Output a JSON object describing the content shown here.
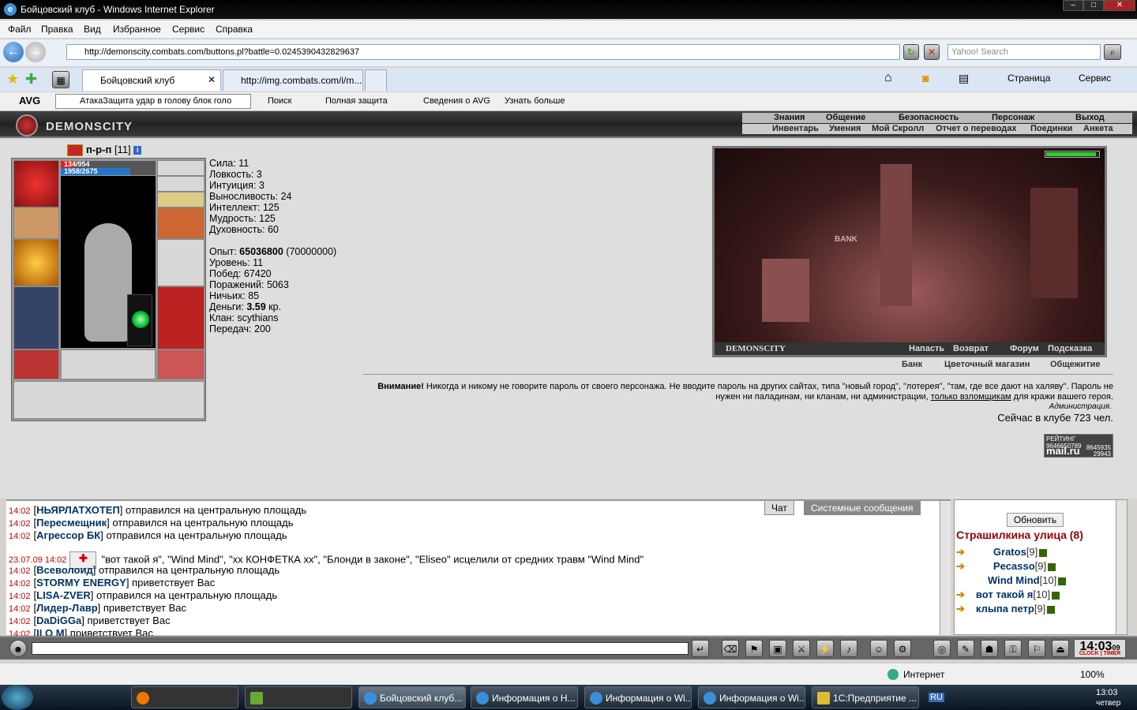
{
  "window": {
    "title": "Бойцовский клуб - Windows Internet Explorer"
  },
  "menu": [
    "Файл",
    "Правка",
    "Вид",
    "Избранное",
    "Сервис",
    "Справка"
  ],
  "address": {
    "url": "http://demonscity.combats.com/buttons.pl?battle=0.0245390432829637",
    "search_placeholder": "Yahoo! Search"
  },
  "tabs": [
    "Бойцовский клуб",
    "http://img.combats.com/i/m..."
  ],
  "ietools": {
    "page": "Страница",
    "service": "Сервис"
  },
  "avg": {
    "label": "AVG",
    "search_value": "АтакаЗащита   удар в голову блок голо",
    "search_btn": "Поиск",
    "full": "Полная защита",
    "info": "Сведения о AVG",
    "more": "Узнать больше"
  },
  "game": {
    "logo": "DEMONSCITY",
    "topnav": [
      "Знания",
      "Общение",
      "Безопасность",
      "Персонаж",
      "Выход"
    ],
    "subnav": [
      "Инвентарь",
      "Умения",
      "Мой Скролл",
      "Отчет о переводах",
      "Поединки",
      "Анкета"
    ]
  },
  "character": {
    "name": "п-р-п",
    "level": "[11]",
    "info_icon": "i",
    "hp": "134/954",
    "hp_fraction": 0.14,
    "mp": "1958/2675",
    "mp_fraction": 0.73,
    "stats": [
      "Сила: 11",
      "Ловкость: 3",
      "Интуиция: 3",
      "Выносливость: 24",
      "Интеллект: 125",
      "Мудрость: 125",
      "Духовность: 60"
    ],
    "exp_label": "Опыт:",
    "exp_value": "65036800",
    "exp_next": "(70000000)",
    "details": [
      "Уровень: 11",
      "Побед: 67420",
      "Поражений: 5063",
      "Ничьих: 85"
    ],
    "money_label": "Деньги:",
    "money_value": "3.59",
    "money_unit": "кр.",
    "details2": [
      "Клан: scythians",
      "Передач: 200"
    ]
  },
  "scene": {
    "bank_sign": "BANK",
    "logo": "DEMONSCITY",
    "actions": [
      "Напасть",
      "Возврат",
      "Форум",
      "Подсказка"
    ],
    "stamina_fraction": 0.95,
    "links": [
      "Банк",
      "Цветочный магазин",
      "Общежитие"
    ]
  },
  "warning": {
    "bold": "Внимание!",
    "text": " Никогда и никому не говорите пароль от своего персонажа. Не вводите пароль на других сайтах, типа \"новый город\", \"лотерея\", \"там, где все дают на халяву\". Пароль не нужен ни паладинам, ни кланам, ни администрации, ",
    "link": "только взломщикам",
    "tail": " для кражи вашего героя.",
    "admin": "Администрация.",
    "online": "Сейчас в клубе 723 чел."
  },
  "rating": {
    "top": "РЕЙТИНГ",
    "n1": "9646650789",
    "brand": "mail.ru",
    "n2": "8645935",
    "n3": "29943"
  },
  "chat": {
    "tabs": [
      "Чат",
      "Системные сообщения"
    ],
    "lines": [
      {
        "time": "14:02",
        "name": "НЬЯРЛАТХОТЕП",
        "text": " отправился на центральную площадь"
      },
      {
        "time": "14:02",
        "name": "Пересмещник",
        "text": " отправился на центральную площадь"
      },
      {
        "time": "14:02",
        "name": "Агрессор БК",
        "text": " отправился на центральную площадь"
      },
      {
        "time": "23.07.09 14:02",
        "name": "",
        "text": "\"вот такой я\", \"Wind Mind\", \"xx КОНФЕТКА xx\", \"Блонди в законе\", \"Eliseo\" исцелили от средних травм \"Wind Mind\""
      },
      {
        "time": "14:02",
        "name": "Всеволоид",
        "text": " отправился на центральную площадь"
      },
      {
        "time": "14:02",
        "name": "STORMY ENERGY",
        "text": " приветствует Вас"
      },
      {
        "time": "14:02",
        "name": "LISA-ZVER",
        "text": " отправился на центральную площадь"
      },
      {
        "time": "14:02",
        "name": "Лидер-Лавр",
        "text": " приветствует Вас"
      },
      {
        "time": "14:02",
        "name": "DaDiGGa",
        "text": " приветствует Вас"
      },
      {
        "time": "14:02",
        "name": "II O M",
        "text": " приветствует Вас"
      }
    ]
  },
  "users": {
    "refresh": "Обновить",
    "location": "Страшилкина улица (8)",
    "list": [
      {
        "name": "Gratos",
        "level": "[9]"
      },
      {
        "name": "Pecasso",
        "level": "[9]"
      },
      {
        "name": "Wind Mind",
        "level": "[10]"
      },
      {
        "name": "вот такой я",
        "level": "[10]"
      },
      {
        "name": "клыпа петр",
        "level": "[9]"
      }
    ]
  },
  "clock": {
    "time": "14:03",
    "sec": "09",
    "labels": "CLOCK | TIMER"
  },
  "status": {
    "zone": "Интернет",
    "zoom": "100%"
  },
  "taskbar": {
    "tasks": [
      "Бойцовский клуб...",
      "Информация о Н...",
      "Информация о Wi...",
      "Информация о Wi...",
      "1С:Предприятие ..."
    ],
    "lang": "RU",
    "time": "13:03",
    "day": "четвер"
  }
}
